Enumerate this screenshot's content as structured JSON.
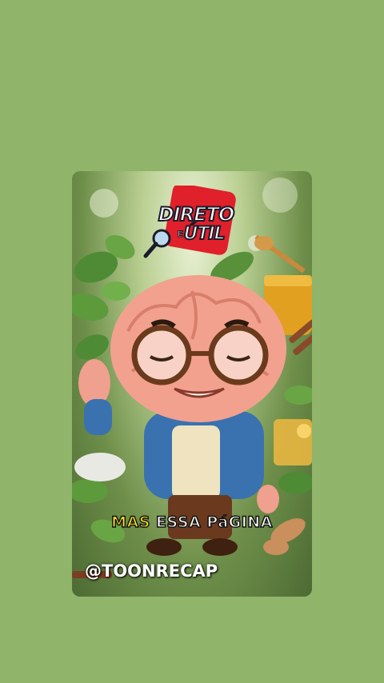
{
  "logo": {
    "line1": "DIRETO",
    "line2": "ÚTIL",
    "connector": "E"
  },
  "caption": {
    "highlight": "MAS",
    "rest": "ESSA PáGINA"
  },
  "handle": "@TOONRECAP",
  "colors": {
    "background": "#8fb46a",
    "logo_red": "#e0202a",
    "caption_highlight": "#ffe21a"
  }
}
